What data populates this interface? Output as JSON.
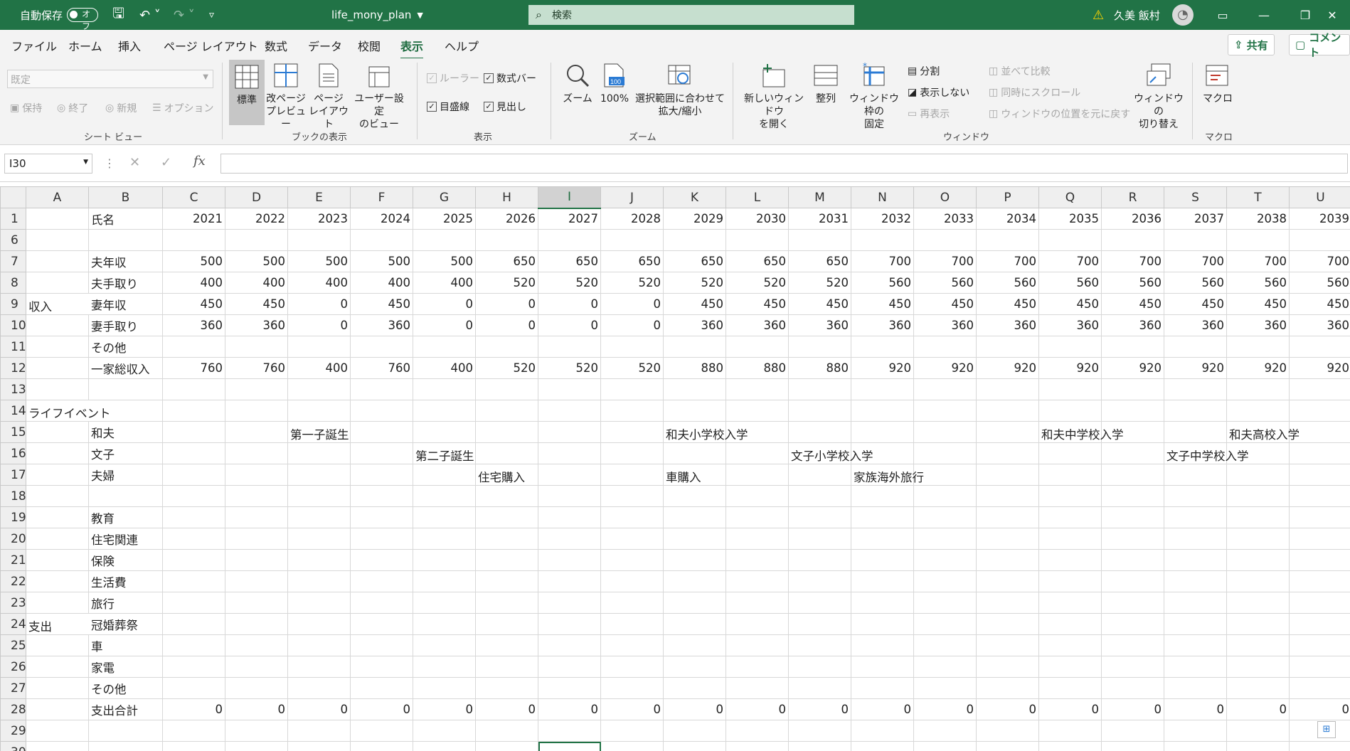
{
  "titlebar": {
    "autosave_label": "自動保存",
    "autosave_state": "オフ",
    "filename": "life_mony_plan",
    "search_placeholder": "検索",
    "user_name": "久美 飯村"
  },
  "tabs": [
    "ファイル",
    "ホーム",
    "挿入",
    "ページ レイアウト",
    "数式",
    "データ",
    "校閲",
    "表示",
    "ヘルプ"
  ],
  "active_tab": "表示",
  "share_label": "共有",
  "comment_label": "コメント",
  "ribbon": {
    "sheet_view": {
      "dropdown_value": "既定",
      "keep": "保持",
      "exit": "終了",
      "new": "新規",
      "options": "オプション",
      "group": "シート ビュー"
    },
    "book_view": {
      "normal": "標準",
      "page_break": "改ページ\nプレビュー",
      "page_layout": "ページ\nレイアウト",
      "custom": "ユーザー設定\nのビュー",
      "group": "ブックの表示"
    },
    "show": {
      "ruler": "ルーラー",
      "formula_bar": "数式バー",
      "gridlines": "目盛線",
      "headings": "見出し",
      "group": "表示"
    },
    "zoom": {
      "zoom": "ズーム",
      "hundred": "100%",
      "fit": "選択範囲に合わせて\n拡大/縮小",
      "group": "ズーム"
    },
    "window": {
      "new_window": "新しいウィンドウ\nを開く",
      "arrange": "整列",
      "freeze": "ウィンドウ枠の\n固定",
      "split": "分割",
      "hide": "表示しない",
      "unhide": "再表示",
      "side_by_side": "並べて比較",
      "sync_scroll": "同時にスクロール",
      "reset_pos": "ウィンドウの位置を元に戻す",
      "switch": "ウィンドウの\n切り替え",
      "group": "ウィンドウ"
    },
    "macro": {
      "macro": "マクロ",
      "group": "マクロ"
    }
  },
  "formula_bar": {
    "name_box": "I30",
    "formula": ""
  },
  "columns": [
    "A",
    "B",
    "C",
    "D",
    "E",
    "F",
    "G",
    "H",
    "I",
    "J",
    "K",
    "L",
    "M",
    "N",
    "O",
    "P",
    "Q",
    "R",
    "S",
    "T",
    "U"
  ],
  "selected_column": "I",
  "rows": [
    {
      "num": "1",
      "b": "氏名",
      "vals": [
        "2021",
        "2022",
        "2023",
        "2024",
        "2025",
        "2026",
        "2027",
        "2028",
        "2029",
        "2030",
        "2031",
        "2032",
        "2033",
        "2034",
        "2035",
        "2036",
        "2037",
        "2038",
        "2039"
      ]
    },
    {
      "num": "6",
      "b": "",
      "vals": []
    },
    {
      "num": "7",
      "b": "夫年収",
      "vals": [
        "500",
        "500",
        "500",
        "500",
        "500",
        "650",
        "650",
        "650",
        "650",
        "650",
        "650",
        "700",
        "700",
        "700",
        "700",
        "700",
        "700",
        "700",
        "700"
      ]
    },
    {
      "num": "8",
      "b": "夫手取り",
      "vals": [
        "400",
        "400",
        "400",
        "400",
        "400",
        "520",
        "520",
        "520",
        "520",
        "520",
        "520",
        "560",
        "560",
        "560",
        "560",
        "560",
        "560",
        "560",
        "560"
      ]
    },
    {
      "num": "9",
      "a": "収入",
      "b": "妻年収",
      "vals": [
        "450",
        "450",
        "0",
        "450",
        "0",
        "0",
        "0",
        "0",
        "450",
        "450",
        "450",
        "450",
        "450",
        "450",
        "450",
        "450",
        "450",
        "450",
        "450"
      ]
    },
    {
      "num": "10",
      "b": "妻手取り",
      "vals": [
        "360",
        "360",
        "0",
        "360",
        "0",
        "0",
        "0",
        "0",
        "360",
        "360",
        "360",
        "360",
        "360",
        "360",
        "360",
        "360",
        "360",
        "360",
        "360"
      ]
    },
    {
      "num": "11",
      "b": "その他",
      "vals": []
    },
    {
      "num": "12",
      "b": "一家総収入",
      "vals": [
        "760",
        "760",
        "400",
        "760",
        "400",
        "520",
        "520",
        "520",
        "880",
        "880",
        "880",
        "920",
        "920",
        "920",
        "920",
        "920",
        "920",
        "920",
        "920"
      ]
    },
    {
      "num": "13",
      "b": "",
      "vals": []
    },
    {
      "num": "14",
      "a": "ライフイベント",
      "b": "",
      "vals": []
    },
    {
      "num": "15",
      "b": "和夫",
      "events": [
        {
          "col": "E",
          "text": "第一子誕生"
        },
        {
          "col": "K",
          "text": "和夫小学校入学"
        },
        {
          "col": "Q",
          "text": "和夫中学校入学"
        },
        {
          "col": "T",
          "text": "和夫高校入学"
        }
      ]
    },
    {
      "num": "16",
      "b": "文子",
      "events": [
        {
          "col": "G",
          "text": "第二子誕生"
        },
        {
          "col": "M",
          "text": "文子小学校入学"
        },
        {
          "col": "S",
          "text": "文子中学校入学"
        }
      ]
    },
    {
      "num": "17",
      "b": "夫婦",
      "events": [
        {
          "col": "H",
          "text": "住宅購入"
        },
        {
          "col": "K",
          "text": "車購入"
        },
        {
          "col": "N",
          "text": "家族海外旅行"
        }
      ]
    },
    {
      "num": "18",
      "b": "",
      "vals": []
    },
    {
      "num": "19",
      "b": "教育",
      "vals": []
    },
    {
      "num": "20",
      "b": "住宅関連",
      "vals": []
    },
    {
      "num": "21",
      "b": "保険",
      "vals": []
    },
    {
      "num": "22",
      "b": "生活費",
      "vals": []
    },
    {
      "num": "23",
      "b": "旅行",
      "vals": []
    },
    {
      "num": "24",
      "a": "支出",
      "b": "冠婚葬祭",
      "vals": []
    },
    {
      "num": "25",
      "b": "車",
      "vals": []
    },
    {
      "num": "26",
      "b": "家電",
      "vals": []
    },
    {
      "num": "27",
      "b": "その他",
      "vals": []
    },
    {
      "num": "28",
      "b": "支出合計",
      "vals": [
        "0",
        "0",
        "0",
        "0",
        "0",
        "0",
        "0",
        "0",
        "0",
        "0",
        "0",
        "0",
        "0",
        "0",
        "0",
        "0",
        "0",
        "0",
        "0"
      ]
    },
    {
      "num": "29",
      "b": "",
      "vals": []
    },
    {
      "num": "30",
      "b": "",
      "vals": []
    }
  ]
}
